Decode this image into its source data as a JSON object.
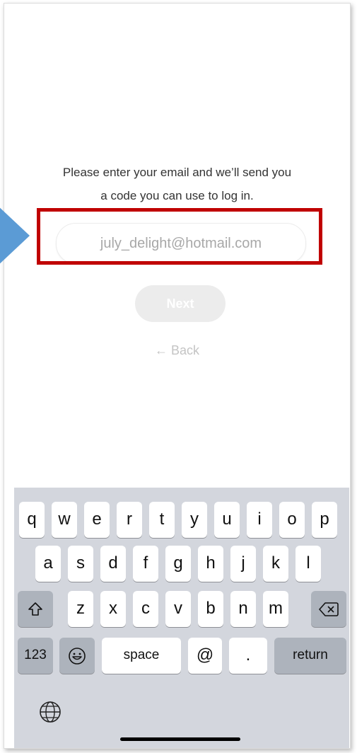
{
  "login": {
    "prompt_line1": "Please enter your email and we’ll send you",
    "prompt_line2": "a code you can use to log in.",
    "email_value": "july_delight@hotmail.com",
    "next_label": "Next",
    "back_label": "← Back"
  },
  "keyboard": {
    "row1": [
      "q",
      "w",
      "e",
      "r",
      "t",
      "y",
      "u",
      "i",
      "o",
      "p"
    ],
    "row2": [
      "a",
      "s",
      "d",
      "f",
      "g",
      "h",
      "j",
      "k",
      "l"
    ],
    "row3": [
      "z",
      "x",
      "c",
      "v",
      "b",
      "n",
      "m"
    ],
    "shift_icon": "shift-icon",
    "backspace_icon": "backspace-icon",
    "numbers_label": "123",
    "emoji_icon": "emoji-icon",
    "space_label": "space",
    "at_label": "@",
    "dot_label": ".",
    "return_label": "return",
    "globe_icon": "globe-icon"
  },
  "annotation": {
    "highlight_color": "#c00000",
    "arrow_color": "#5b9bd5"
  }
}
